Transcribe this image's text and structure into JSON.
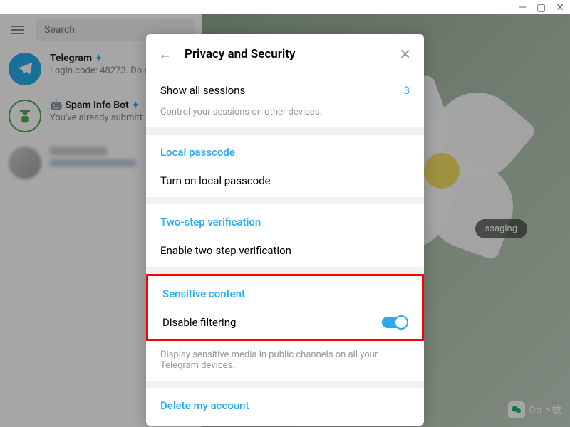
{
  "window": {
    "minimize": "—",
    "maximize": "▢",
    "close": "✕"
  },
  "sidebar": {
    "search_placeholder": "Search",
    "chats": [
      {
        "title": "Telegram",
        "subtitle": "Login code: 48273. Do n",
        "verified": true
      },
      {
        "title": "Spam Info Bot",
        "subtitle": "You've already submitt",
        "verified": true,
        "bot_icon": "🤖"
      }
    ]
  },
  "main": {
    "badge_text": "ssaging"
  },
  "modal": {
    "title": "Privacy and Security",
    "sessions": {
      "label": "Show all sessions",
      "count": "3",
      "desc": "Control your sessions on other devices."
    },
    "passcode": {
      "heading": "Local passcode",
      "action": "Turn on local passcode"
    },
    "twostep": {
      "heading": "Two-step verification",
      "action": "Enable two-step verification"
    },
    "sensitive": {
      "heading": "Sensitive content",
      "action": "Disable filtering",
      "desc": "Display sensitive media in public channels on all your Telegram devices."
    },
    "delete": {
      "heading": "Delete my account"
    }
  },
  "watermark": {
    "text": "Ob下载"
  }
}
